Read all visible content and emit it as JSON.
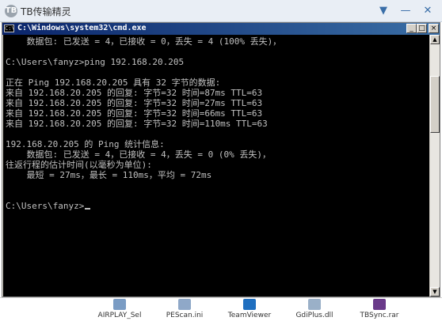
{
  "app": {
    "title": "TB传输精灵",
    "logo_text": "TB",
    "menu_glyph": "▼",
    "minimize_glyph": "—",
    "close_glyph": "✕"
  },
  "cmd": {
    "title": "C:\\Windows\\system32\\cmd.exe",
    "icon_text": "C:\\",
    "lines": [
      "    数据包: 已发送 = 4，已接收 = 0，丢失 = 4 (100% 丢失)，",
      "",
      "C:\\Users\\fanyz>ping 192.168.20.205",
      "",
      "正在 Ping 192.168.20.205 具有 32 字节的数据:",
      "来自 192.168.20.205 的回复: 字节=32 时间=87ms TTL=63",
      "来自 192.168.20.205 的回复: 字节=32 时间=27ms TTL=63",
      "来自 192.168.20.205 的回复: 字节=32 时间=66ms TTL=63",
      "来自 192.168.20.205 的回复: 字节=32 时间=110ms TTL=63",
      "",
      "192.168.20.205 的 Ping 统计信息:",
      "    数据包: 已发送 = 4，已接收 = 4，丢失 = 0 (0% 丢失)，",
      "往返行程的估计时间(以毫秒为单位):",
      "    最短 = 27ms，最长 = 110ms，平均 = 72ms",
      "",
      "C:\\Users\\fanyz>"
    ]
  },
  "desktop": {
    "files": [
      {
        "name": "AIRPLAY_Sel",
        "color": "#7a9cc4"
      },
      {
        "name": "PEScan.ini",
        "color": "#8fa8c8"
      },
      {
        "name": "TeamViewer",
        "color": "#1f6fc0"
      },
      {
        "name": "GdiPlus.dll",
        "color": "#9ab0c8"
      },
      {
        "name": "TBSync.rar",
        "color": "#6a3a8a"
      }
    ]
  }
}
